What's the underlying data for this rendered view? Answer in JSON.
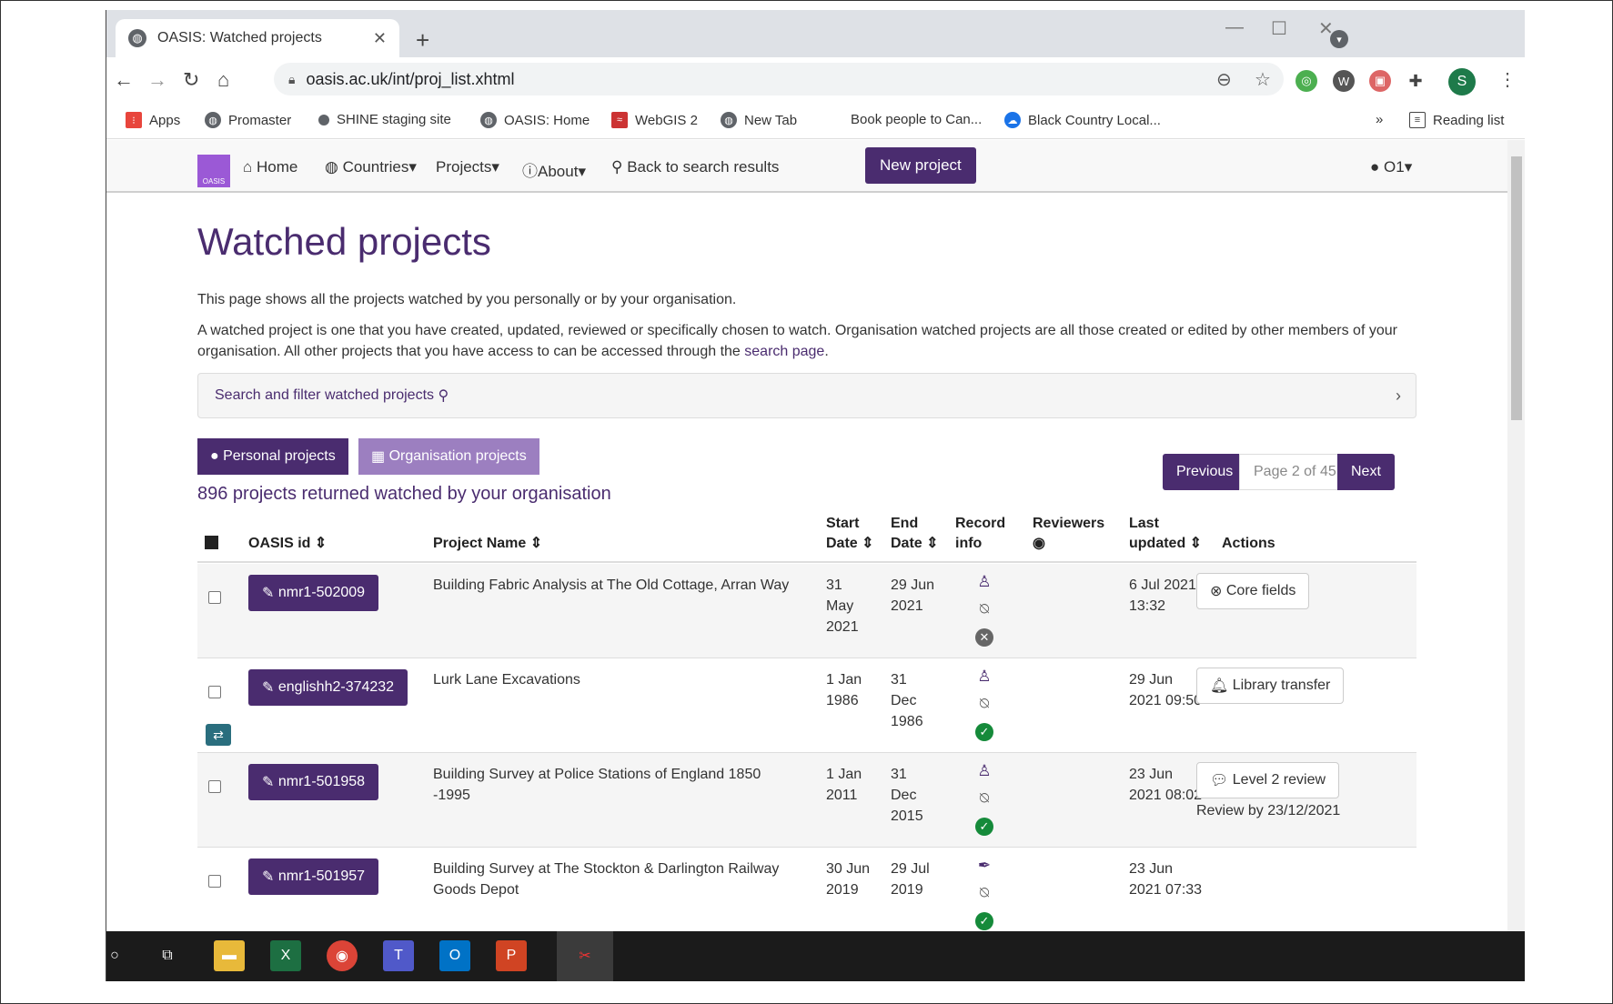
{
  "browser": {
    "tab_title": "OASIS: Watched projects",
    "tab_close": "✕",
    "new_tab": "+",
    "url": "oasis.ac.uk/int/proj_list.xhtml",
    "avatar_initial": "S",
    "window_controls": [
      "—",
      "☐",
      "✕"
    ],
    "bookmarks": [
      "Apps",
      "Promaster",
      "SHINE staging site",
      "OASIS: Home",
      "WebGIS 2",
      "New Tab",
      "Book people to Can...",
      "Black Country Local...",
      "»",
      "Reading list"
    ]
  },
  "site_nav": {
    "logo_text": "OASIS",
    "home": "Home",
    "countries": "Countries",
    "projects": "Projects",
    "about": "About",
    "back": "Back to search results",
    "new_project": "New project",
    "user": "O1"
  },
  "page": {
    "title": "Watched projects",
    "intro": "This page shows all the projects watched by you personally or by your organisation.",
    "description": "A watched project is one that you have created, updated, reviewed or specifically chosen to watch. Organisation watched projects are all those created or edited by other members of your organisation. All other projects that you have access to can be accessed through the",
    "search_link": "search page",
    "period": ".",
    "filter_label": "Search and filter watched projects",
    "tab_personal": "Personal projects",
    "tab_org": "Organisation projects",
    "count_text": "896 projects returned watched by your organisation",
    "pager": {
      "previous": "Previous",
      "page": "Page 2 of 45",
      "next": "Next"
    }
  },
  "table": {
    "headers": {
      "oasis_id": "OASIS id",
      "project_name": "Project Name",
      "start_date": [
        "Start",
        "Date"
      ],
      "end_date": [
        "End",
        "Date"
      ],
      "record_info": [
        "Record",
        "info"
      ],
      "reviewers": "Reviewers",
      "last_updated": [
        "Last",
        "updated"
      ],
      "actions": "Actions"
    },
    "rows": [
      {
        "id": "nmr1-502009",
        "name": [
          "Building Fabric Analysis at The Old Cottage, Arran Way"
        ],
        "start": [
          "31",
          "May",
          "2021"
        ],
        "end": [
          "29 Jun",
          "2021"
        ],
        "updated": [
          "6 Jul 2021",
          "13:32"
        ],
        "action": "Core fields",
        "action_note": "",
        "status": "x"
      },
      {
        "id": "englishh2-374232",
        "name": [
          "Lurk Lane Excavations"
        ],
        "start": [
          "1 Jan",
          "1986"
        ],
        "end": [
          "31",
          "Dec",
          "1986"
        ],
        "updated": [
          "29 Jun",
          "2021 09:50"
        ],
        "action": "Library transfer",
        "action_note": "",
        "status": "ok"
      },
      {
        "id": "nmr1-501958",
        "name": [
          "Building Survey at Police Stations of England 1850",
          "-1995"
        ],
        "start": [
          "1 Jan",
          "2011"
        ],
        "end": [
          "31",
          "Dec",
          "2015"
        ],
        "updated": [
          "23 Jun",
          "2021 08:02"
        ],
        "action": "Level 2 review",
        "action_note": "Review by 23/12/2021",
        "status": "ok"
      },
      {
        "id": "nmr1-501957",
        "name": [
          "Building Survey at The Stockton & Darlington Railway",
          "Goods Depot"
        ],
        "start": [
          "30 Jun",
          "2019"
        ],
        "end": [
          "29 Jul",
          "2019"
        ],
        "updated": [
          "23 Jun",
          "2021 07:33"
        ],
        "action": "",
        "action_note": "",
        "status": "ok"
      }
    ]
  },
  "colors": {
    "brand_purple": "#4a2c6f",
    "tab_light_purple": "#9c7fc0",
    "ok_green": "#158a3a",
    "transfer_teal": "#2a6e7e"
  },
  "icons": [
    "globe-icon",
    "home-icon",
    "info-icon",
    "search-icon",
    "edit-icon",
    "award-icon",
    "bell-slash-icon",
    "check-circle-icon",
    "times-circle-icon",
    "quill-icon",
    "eye-icon",
    "user-icon",
    "bell-icon",
    "comments-icon",
    "exchange-icon"
  ]
}
